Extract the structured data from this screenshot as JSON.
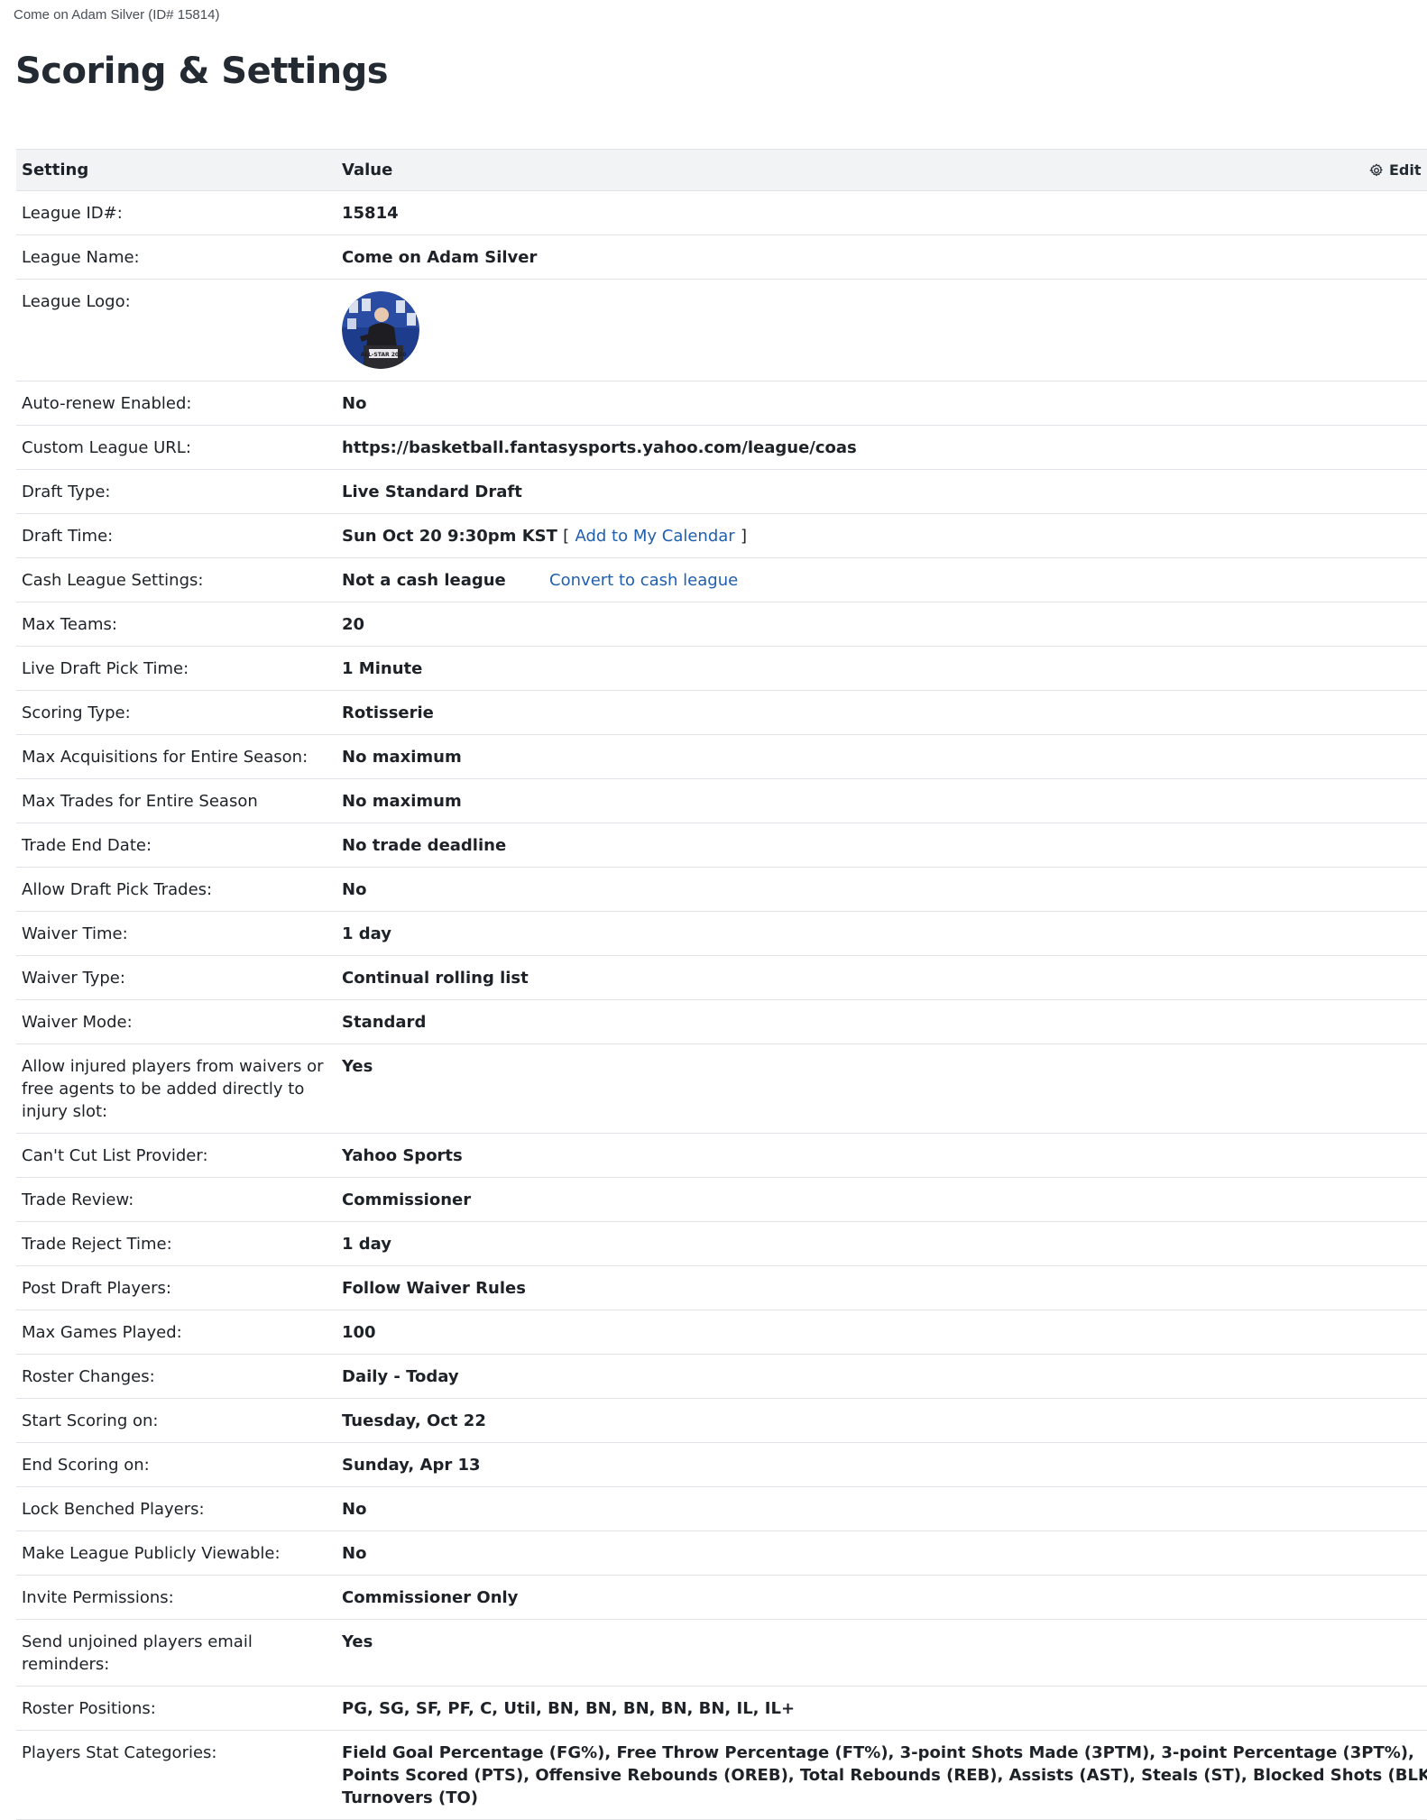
{
  "breadcrumb": "Come on Adam Silver (ID# 15814)",
  "title": "Scoring & Settings",
  "table": {
    "col_setting": "Setting",
    "col_value": "Value",
    "edit_label": "Edit"
  },
  "rows": {
    "league_id": {
      "label": "League ID#:",
      "value": "15814"
    },
    "league_name": {
      "label": "League Name:",
      "value": "Come on Adam Silver"
    },
    "league_logo": {
      "label": "League Logo:",
      "logo_text": "ALL-STAR 2020"
    },
    "auto_renew": {
      "label": "Auto-renew Enabled:",
      "value": "No"
    },
    "custom_url": {
      "label": "Custom League URL:",
      "value": "https://basketball.fantasysports.yahoo.com/league/coas"
    },
    "draft_type": {
      "label": "Draft Type:",
      "value": "Live Standard Draft"
    },
    "draft_time": {
      "label": "Draft Time:",
      "value": "Sun Oct 20 9:30pm KST",
      "bracket_open": "[",
      "link": "Add to My Calendar",
      "bracket_close": "]"
    },
    "cash_league": {
      "label": "Cash League Settings:",
      "value": "Not a cash league",
      "link": "Convert to cash league"
    },
    "max_teams": {
      "label": "Max Teams:",
      "value": "20"
    },
    "pick_time": {
      "label": "Live Draft Pick Time:",
      "value": "1 Minute"
    },
    "scoring_type": {
      "label": "Scoring Type:",
      "value": "Rotisserie"
    },
    "max_acquisitions": {
      "label": "Max Acquisitions for Entire Season:",
      "value": "No maximum"
    },
    "max_trades": {
      "label": "Max Trades for Entire Season",
      "value": "No maximum"
    },
    "trade_end": {
      "label": "Trade End Date:",
      "value": "No trade deadline"
    },
    "draft_pick_trades": {
      "label": "Allow Draft Pick Trades:",
      "value": "No"
    },
    "waiver_time": {
      "label": "Waiver Time:",
      "value": "1 day"
    },
    "waiver_type": {
      "label": "Waiver Type:",
      "value": "Continual rolling list"
    },
    "waiver_mode": {
      "label": "Waiver Mode:",
      "value": "Standard"
    },
    "injured_players": {
      "label": "Allow injured players from waivers or free agents to be added directly to injury slot:",
      "value": "Yes"
    },
    "cant_cut": {
      "label": "Can't Cut List Provider:",
      "value": "Yahoo Sports"
    },
    "trade_review": {
      "label": "Trade Review:",
      "value": "Commissioner"
    },
    "trade_reject": {
      "label": "Trade Reject Time:",
      "value": "1 day"
    },
    "post_draft": {
      "label": "Post Draft Players:",
      "value": "Follow Waiver Rules"
    },
    "max_games": {
      "label": "Max Games Played:",
      "value": "100"
    },
    "roster_changes": {
      "label": "Roster Changes:",
      "value": "Daily - Today"
    },
    "start_scoring": {
      "label": "Start Scoring on:",
      "value": "Tuesday, Oct 22"
    },
    "end_scoring": {
      "label": "End Scoring on:",
      "value": "Sunday, Apr 13"
    },
    "lock_benched": {
      "label": "Lock Benched Players:",
      "value": "No"
    },
    "public": {
      "label": "Make League Publicly Viewable:",
      "value": "No"
    },
    "invite": {
      "label": "Invite Permissions:",
      "value": "Commissioner Only"
    },
    "reminders": {
      "label": "Send unjoined players email reminders:",
      "value": "Yes"
    },
    "roster_positions": {
      "label": "Roster Positions:",
      "value": "PG, SG, SF, PF, C, Util, BN, BN, BN, BN, BN, IL, IL+"
    },
    "stat_categories": {
      "label": "Players Stat Categories:",
      "value": "Field Goal Percentage (FG%), Free Throw Percentage (FT%), 3-point Shots Made (3PTM), 3-point Percentage (3PT%), Points Scored (PTS), Offensive Rebounds (OREB), Total Rebounds (REB), Assists (AST), Steals (ST), Blocked Shots (BLK), Turnovers (TO)"
    }
  },
  "colors": {
    "link": "#1f5fae",
    "header_bg": "#f1f3f5",
    "border": "#e0e4e9",
    "logo_bg": "#1e3c8c"
  }
}
